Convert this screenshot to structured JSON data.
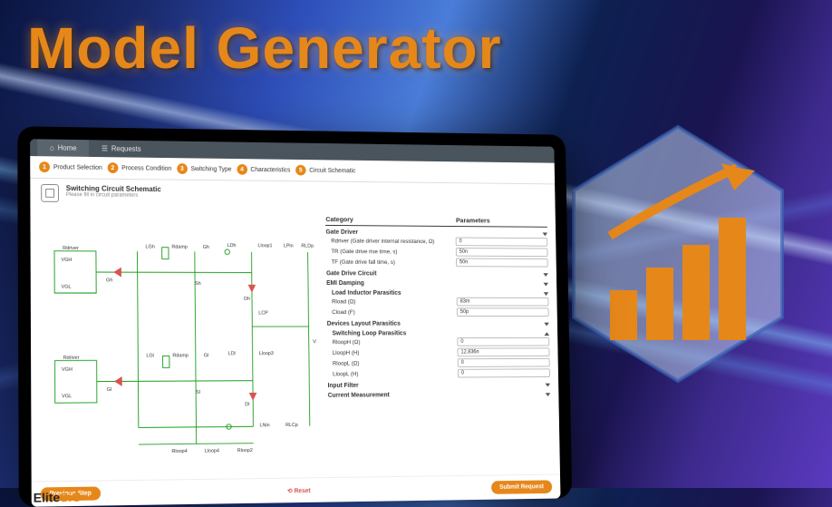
{
  "hero": {
    "title": "Model Generator"
  },
  "tabs": [
    {
      "label": "Home"
    },
    {
      "label": "Requests"
    }
  ],
  "steps": [
    {
      "num": "1",
      "label": "Product Selection"
    },
    {
      "num": "2",
      "label": "Process Condition"
    },
    {
      "num": "3",
      "label": "Switching Type"
    },
    {
      "num": "4",
      "label": "Characteristics"
    },
    {
      "num": "5",
      "label": "Circuit Schematic"
    }
  ],
  "section": {
    "title": "Switching Circuit Schematic",
    "subtitle": "Please fill in circuit parameters"
  },
  "params": {
    "header": {
      "category": "Category",
      "parameters": "Parameters"
    },
    "groups": [
      {
        "name": "Gate Driver",
        "items": [
          {
            "label": "Rdriver (Gate driver internal resistance, Ω)",
            "value": "0"
          },
          {
            "label": "TR (Gate drive rise time, s)",
            "value": "50n"
          },
          {
            "label": "TF (Gate drive fall time, s)",
            "value": "50n"
          }
        ]
      },
      {
        "name": "Gate Drive Circuit",
        "items": []
      },
      {
        "name": "EMI Damping",
        "items": []
      },
      {
        "name": "Load Inductor Parasitics",
        "items": [
          {
            "label": "Rload (Ω)",
            "value": "83m"
          },
          {
            "label": "Cload (F)",
            "value": "50p"
          }
        ]
      },
      {
        "name": "Devices Layout Parasitics",
        "items": []
      },
      {
        "name": "Switching Loop Parasitics",
        "items": [
          {
            "label": "RloopH (Ω)",
            "value": "0"
          },
          {
            "label": "LloopH (H)",
            "value": "12.836n"
          },
          {
            "label": "RloopL (Ω)",
            "value": "0"
          },
          {
            "label": "LloopL (H)",
            "value": "0"
          }
        ]
      },
      {
        "name": "Input Filter",
        "items": []
      },
      {
        "name": "Current Measurement",
        "items": []
      }
    ]
  },
  "footer": {
    "prev": "Previous Step",
    "reset": "Reset",
    "submit": "Submit Request"
  },
  "brand": {
    "name": "EliteSiC"
  },
  "colors": {
    "accent": "#e6871a",
    "schematic": "#1a9c1a",
    "danger": "#d9534f"
  }
}
